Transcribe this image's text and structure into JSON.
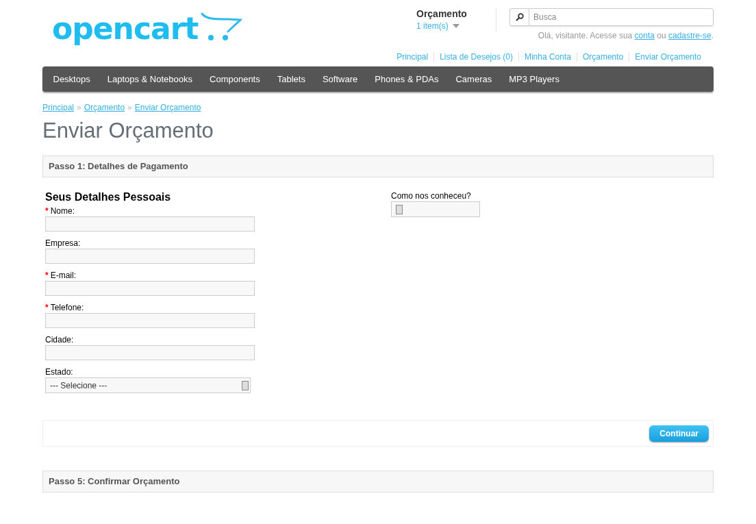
{
  "logo": {
    "text": "opencart"
  },
  "cart": {
    "title": "Orçamento",
    "items": "1 item(s)"
  },
  "search": {
    "placeholder": "Busca"
  },
  "welcome": {
    "before": "Olá, visitante. Acesse sua ",
    "link1": "conta",
    "middle": " ou ",
    "link2": "cadastre-se",
    "after": "."
  },
  "top_links": [
    "Principal",
    "Lista de Desejos (0)",
    "Minha Conta",
    "Orçamento",
    "Enviar Orçamento"
  ],
  "menu": [
    "Desktops",
    "Laptops & Notebooks",
    "Components",
    "Tablets",
    "Software",
    "Phones & PDAs",
    "Cameras",
    "MP3 Players"
  ],
  "breadcrumb": [
    {
      "label": "Principal"
    },
    {
      "separator": "»",
      "label": "Orçamento"
    },
    {
      "separator": "»",
      "label": "Enviar Orçamento"
    }
  ],
  "required_mark": "*",
  "title": "Enviar Orçamento",
  "step1": {
    "heading": "Passo 1: Detalhes de Pagamento"
  },
  "personal": {
    "heading": "Seus Detalhes Pessoais",
    "fields": [
      {
        "label": "Nome:",
        "required": true,
        "kind": "text"
      },
      {
        "label": "Empresa:",
        "required": false,
        "kind": "text"
      },
      {
        "label": "E-mail:",
        "required": true,
        "kind": "text"
      },
      {
        "label": "Telefone:",
        "required": true,
        "kind": "text"
      },
      {
        "label": "Cidade:",
        "required": false,
        "kind": "text"
      },
      {
        "label": "Estado:",
        "required": false,
        "kind": "select",
        "value": "--- Selecione ---"
      }
    ]
  },
  "referral": {
    "label": "Como nos conheceu?"
  },
  "continue_button": "Continuar",
  "step5": {
    "heading": "Passo 5: Confirmar Orçamento"
  }
}
